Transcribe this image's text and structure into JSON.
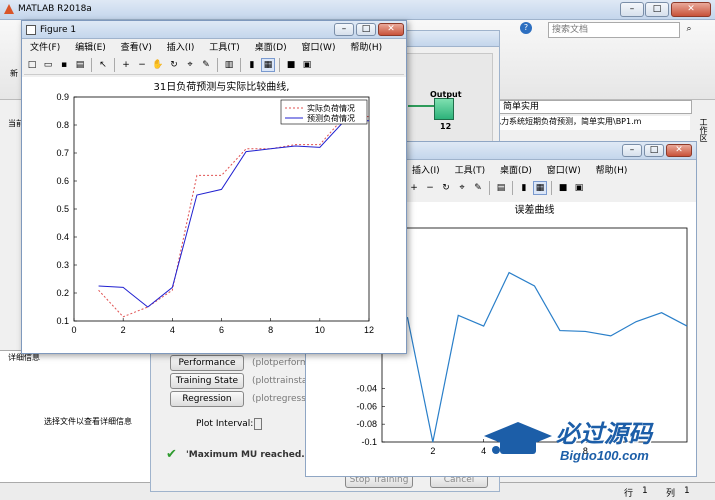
{
  "matlab": {
    "title": "MATLAB R2018a",
    "search_placeholder": "搜索文档",
    "path_text": "，简单实用",
    "path_text2": "电力系统短期负荷预测，简单实用\\BP1.m",
    "workspace_label": "工作区",
    "left_label1": "当前",
    "left_label2": "新",
    "detail_header": "详细信息",
    "detail_text": "选择文件以查看详细信息",
    "status_row": "行",
    "status_row_val": "1",
    "status_col": "列",
    "status_col_val": "1"
  },
  "nntool": {
    "output_label": "Output",
    "output_size": "12",
    "buttons": [
      "Performance",
      "Training State",
      "Regression"
    ],
    "button_hints": [
      "(plotperform",
      "(plottrainstate",
      "(plotregressio"
    ],
    "plot_interval": "Plot Interval:",
    "status": "'Maximum MU reached.'",
    "bottom_buttons": [
      "Stop Training",
      "Cancel"
    ]
  },
  "fig1": {
    "title": "Figure 1",
    "menu": [
      "文件(F)",
      "编辑(E)",
      "查看(V)",
      "插入(I)",
      "工具(T)",
      "桌面(D)",
      "窗口(W)",
      "帮助(H)"
    ]
  },
  "fig2": {
    "menu": [
      "插入(I)",
      "工具(T)",
      "桌面(D)",
      "窗口(W)",
      "帮助(H)"
    ]
  },
  "watermark": {
    "cn": "必过源码",
    "url": "Biguo100.com"
  },
  "chart_data": [
    {
      "type": "line",
      "title": "31日负荷预测与实际比较曲线,",
      "xlim": [
        0,
        12
      ],
      "ylim": [
        0.1,
        0.9
      ],
      "x_ticks": [
        "0",
        "2",
        "4",
        "6",
        "8",
        "10",
        "12"
      ],
      "y_ticks": [
        "0.1",
        "0.2",
        "0.3",
        "0.4",
        "0.5",
        "0.6",
        "0.7",
        "0.8",
        "0.9"
      ],
      "x": [
        1,
        2,
        3,
        4,
        5,
        6,
        7,
        8,
        9,
        10,
        11,
        12
      ],
      "series": [
        {
          "name": "实际负荷情况",
          "color": "#e05050",
          "style": "dotted",
          "values": [
            0.21,
            0.115,
            0.15,
            0.21,
            0.62,
            0.62,
            0.715,
            0.715,
            0.73,
            0.73,
            0.83,
            0.83
          ]
        },
        {
          "name": "预测负荷情况",
          "color": "#2020d0",
          "style": "solid",
          "values": [
            0.225,
            0.22,
            0.15,
            0.22,
            0.55,
            0.57,
            0.705,
            0.715,
            0.725,
            0.72,
            0.815,
            0.815
          ]
        }
      ]
    },
    {
      "type": "line",
      "title": "误差曲线",
      "xlim": [
        0,
        12
      ],
      "ylim": [
        -0.1,
        0.14
      ],
      "x_ticks": [
        "2",
        "4",
        "8"
      ],
      "y_ticks": [
        "-0.04",
        "-0.06",
        "-0.08",
        "-0.1"
      ],
      "x": [
        1,
        2,
        3,
        4,
        5,
        6,
        7,
        8,
        9,
        10,
        11,
        12
      ],
      "series": [
        {
          "color": "#2a7fc9",
          "values": [
            0.04,
            -0.1,
            0.042,
            0.03,
            0.09,
            0.075,
            0.025,
            0.024,
            0.019,
            0.035,
            0.045,
            0.03
          ]
        }
      ]
    }
  ]
}
